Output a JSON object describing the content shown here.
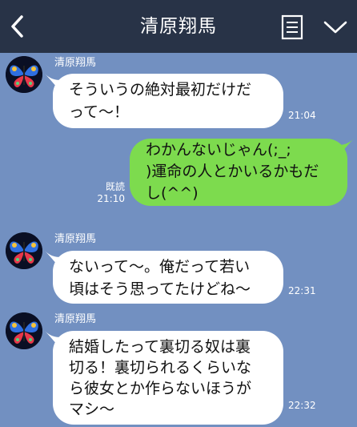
{
  "header": {
    "title": "清原翔馬",
    "back_icon": "chevron-left-icon",
    "menu_icon": "list-icon",
    "dropdown_icon": "chevron-down-icon"
  },
  "colors": {
    "background": "#7290c1",
    "header": "#283347",
    "incoming_bubble": "#ffffff",
    "outgoing_bubble": "#7ddb4e"
  },
  "messages": [
    {
      "direction": "incoming",
      "sender": "清原翔馬",
      "lines": [
        "そういうの絶対最初だけだ",
        "って〜！"
      ],
      "time": "21:04"
    },
    {
      "direction": "outgoing",
      "lines": [
        "わかんないじゃん(;_;",
        ")運命の人とかいるかもだ",
        "し(^^)"
      ],
      "read": "既読",
      "time": "21:10"
    },
    {
      "direction": "incoming",
      "sender": "清原翔馬",
      "lines": [
        "ないって〜。俺だって若い",
        "頃はそう思ってたけどね〜"
      ],
      "time": "22:31"
    },
    {
      "direction": "incoming",
      "sender": "清原翔馬",
      "lines": [
        "結婚したって裏切る奴は裏",
        "切る！裏切られるくらいな",
        "ら彼女とか作らないほうが",
        "マシ〜"
      ],
      "time": "22:32"
    }
  ]
}
